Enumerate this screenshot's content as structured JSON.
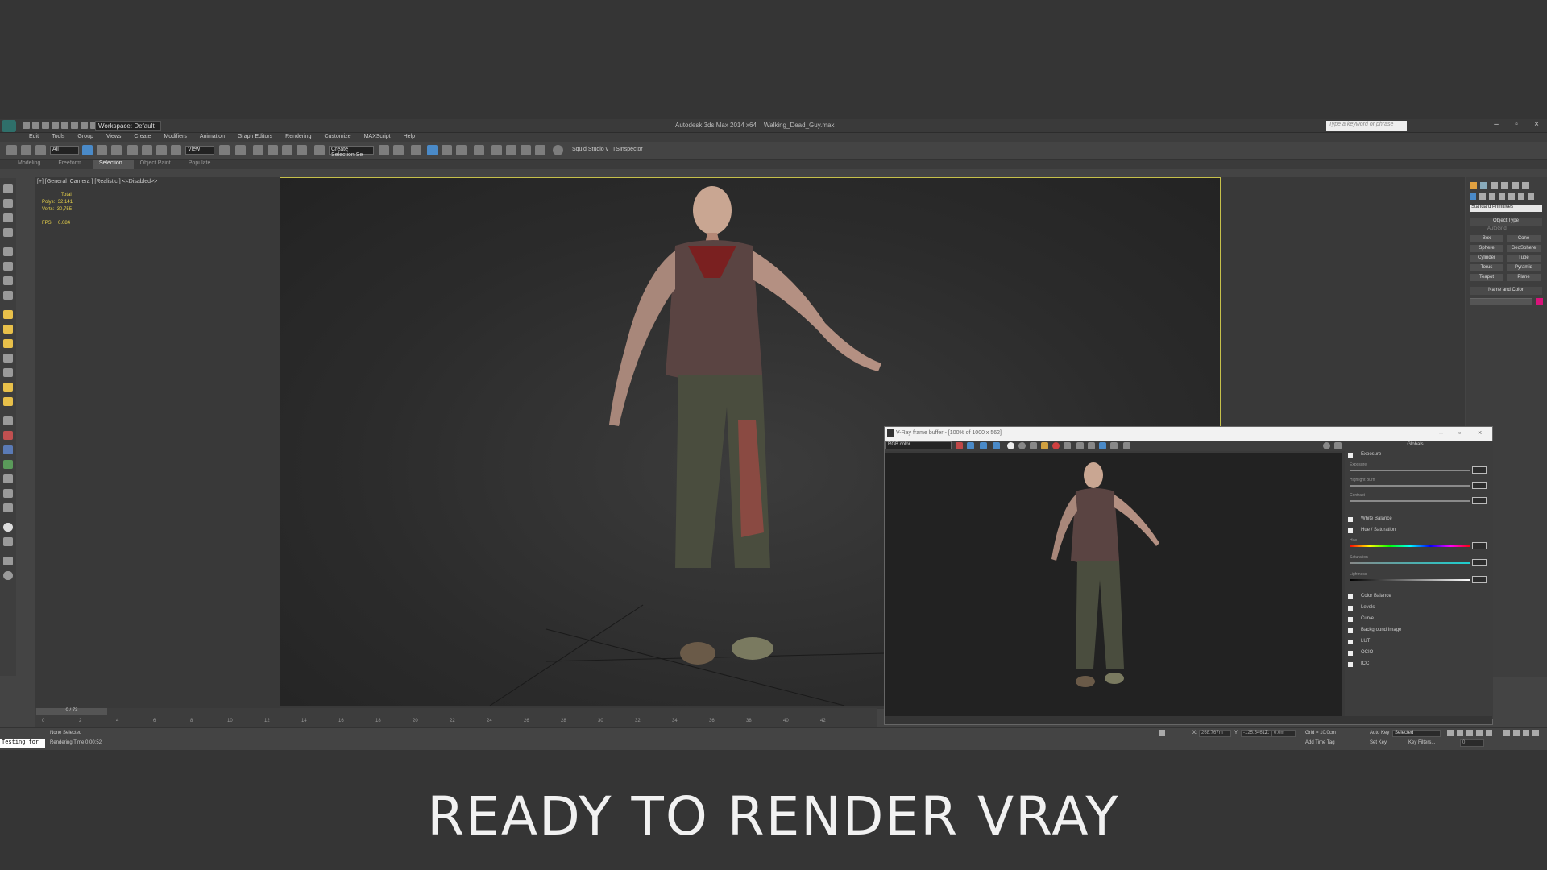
{
  "window": {
    "workspace": "Workspace: Default",
    "title": "Autodesk 3ds Max 2014 x64",
    "file_name": "Walking_Dead_Guy.max",
    "search_placeholder": "Type a keyword or phrase"
  },
  "menu": [
    "Edit",
    "Tools",
    "Group",
    "Views",
    "Create",
    "Modifiers",
    "Animation",
    "Graph Editors",
    "Rendering",
    "Customize",
    "MAXScript",
    "Help"
  ],
  "toolbar": {
    "filter": "All",
    "ref_coord": "View",
    "named_sel": "Create Selection Se",
    "plugin1": "Squid Studio v",
    "plugin2": "TSInspector"
  },
  "ribbon_tabs": [
    "Modeling",
    "Freeform",
    "Selection",
    "Object Paint",
    "Populate"
  ],
  "ribbon_active": "Selection",
  "viewport": {
    "label": "[+] [General_Camera ] [Realistic ] <<Disabled>>",
    "stats_total": "Total",
    "polys_label": "Polys:",
    "polys_value": "32,141",
    "verts_label": "Verts:",
    "verts_value": "30,755",
    "fps_label": "FPS:",
    "fps_value": "0.084"
  },
  "command_panel": {
    "dropdown": "Standard Primitives",
    "object_type": "Object Type",
    "autogrid": "AutoGrid",
    "primitives": [
      "Box",
      "Cone",
      "Sphere",
      "GeoSphere",
      "Cylinder",
      "Tube",
      "Torus",
      "Pyramid",
      "Teapot",
      "Plane"
    ],
    "name_and_color": "Name and Color",
    "color": "#d9137a"
  },
  "frame_buffer": {
    "title": "V-Ray frame buffer - [100% of 1000 x 562]",
    "channel": "RGB color",
    "globals": "Globals...",
    "exposure": "Exposure",
    "exposure_sub": [
      "Exposure",
      "Highlight Burn",
      "Contrast"
    ],
    "white_balance": "White Balance",
    "hue_saturation": "Hue / Saturation",
    "hue_sub": [
      "Hue",
      "Saturation",
      "Lightness"
    ],
    "layers": [
      "Color Balance",
      "Levels",
      "Curve",
      "Background Image",
      "LUT",
      "OCIO",
      "ICC"
    ]
  },
  "timeline": {
    "frame": "0 / 73",
    "ticks": [
      "0",
      "2",
      "4",
      "6",
      "8",
      "10",
      "12",
      "14",
      "16",
      "18",
      "20",
      "22",
      "24",
      "26",
      "28",
      "30",
      "32",
      "34",
      "36",
      "38",
      "40",
      "42"
    ]
  },
  "status": {
    "maxscript": "Testing for",
    "selection": "None Selected",
    "render_time": "Rendering Time 0:00:52",
    "x_label": "X:",
    "x_value": "268.767m",
    "y_label": "Y:",
    "y_value": "-125.5461",
    "z_label": "Z:",
    "z_value": "0.0m",
    "grid": "Grid = 10.0cm",
    "add_time_tag": "Add Time Tag",
    "auto_key": "Auto Key",
    "auto_key_sel": "Selected",
    "set_key": "Set Key",
    "key_filters": "Key Filters...",
    "frame_field": "0"
  },
  "caption": "READY TO RENDER VRAY"
}
